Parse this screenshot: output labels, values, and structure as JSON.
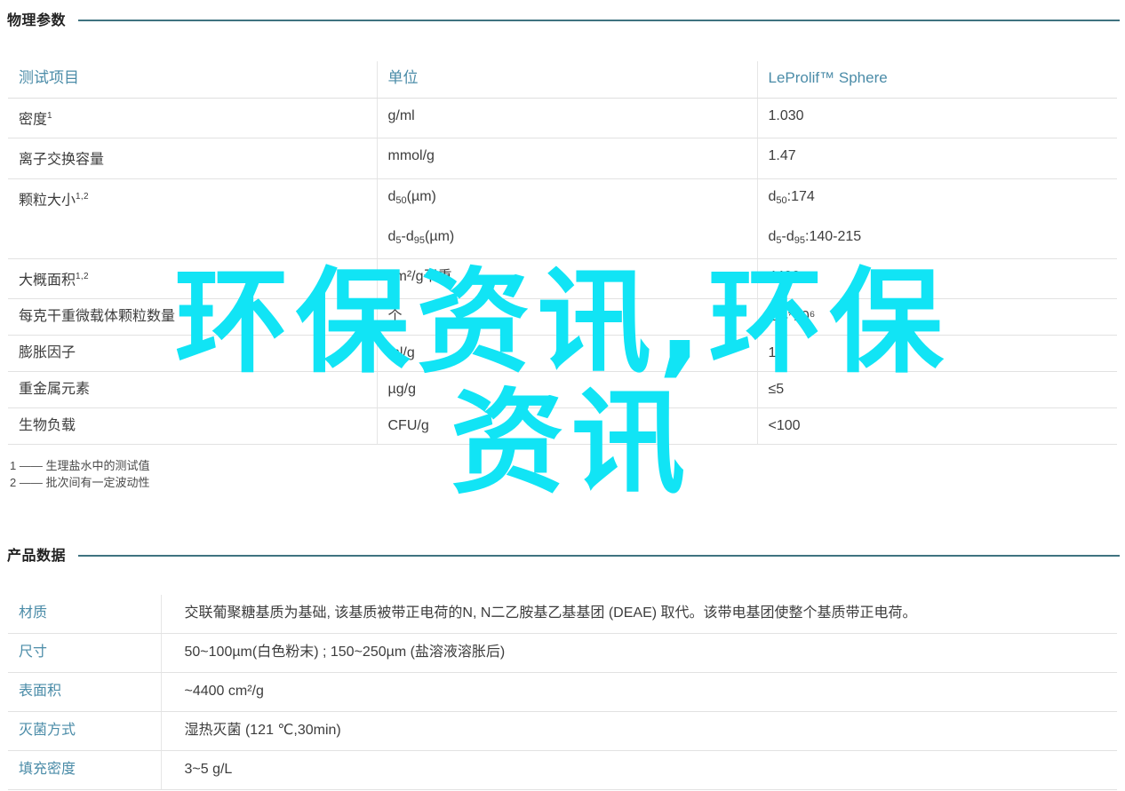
{
  "physical_section": {
    "heading": "物理参数",
    "table": {
      "headers": [
        "测试项目",
        "单位",
        "LeProlif™ Sphere"
      ],
      "rows": [
        {
          "item": "密度",
          "item_footnote": "1",
          "unit": "g/ml",
          "value": "1.030"
        },
        {
          "item": "离子交换容量",
          "item_footnote": "",
          "unit": "mmol/g",
          "value": "1.47"
        },
        {
          "item": "颗粒大小",
          "item_footnote": "1,2",
          "unit_lines": [
            "d50(µm)",
            "d5-d95(µm)"
          ],
          "value_lines": [
            "d50:174",
            "d5-d95:140-215"
          ]
        },
        {
          "item": "大概面积",
          "item_footnote": "1,2",
          "unit": "cm²/g干重",
          "value": "4400"
        },
        {
          "item": "每克干重微载体颗粒数量",
          "item_footnote": "",
          "unit": "个",
          "value": "1.4*10⁶"
        },
        {
          "item": "膨胀因子",
          "item_footnote": "",
          "unit": "ml/g",
          "value": "17"
        },
        {
          "item": "重金属元素",
          "item_footnote": "",
          "unit": "µg/g",
          "value": "≤5"
        },
        {
          "item": "生物负载",
          "item_footnote": "",
          "unit": "CFU/g",
          "value": "<100"
        }
      ]
    },
    "footnotes": [
      "1 —— 生理盐水中的测试值",
      "2 —— 批次间有一定波动性"
    ]
  },
  "product_section": {
    "heading": "产品数据",
    "rows": [
      {
        "key": "材质",
        "value": "交联葡聚糖基质为基础, 该基质被带正电荷的N, N二乙胺基乙基基团 (DEAE) 取代。该带电基团使整个基质带正电荷。"
      },
      {
        "key": "尺寸",
        "value": "50~100µm(白色粉末) ; 150~250µm (盐溶液溶胀后)"
      },
      {
        "key": "表面积",
        "value": "~4400 cm²/g"
      },
      {
        "key": "灭菌方式",
        "value": "湿热灭菌 (121 ℃,30min)"
      },
      {
        "key": "填充密度",
        "value": "3~5 g/L"
      }
    ]
  },
  "watermark": {
    "line1": "环保资讯,环保",
    "line2": "资讯",
    "color": "#11e4f5"
  },
  "colors": {
    "header_text": "#4b8ca8",
    "heading_rule": "#3f7380",
    "body_text": "#3d3d3d",
    "row_border": "#e2e2e2"
  }
}
